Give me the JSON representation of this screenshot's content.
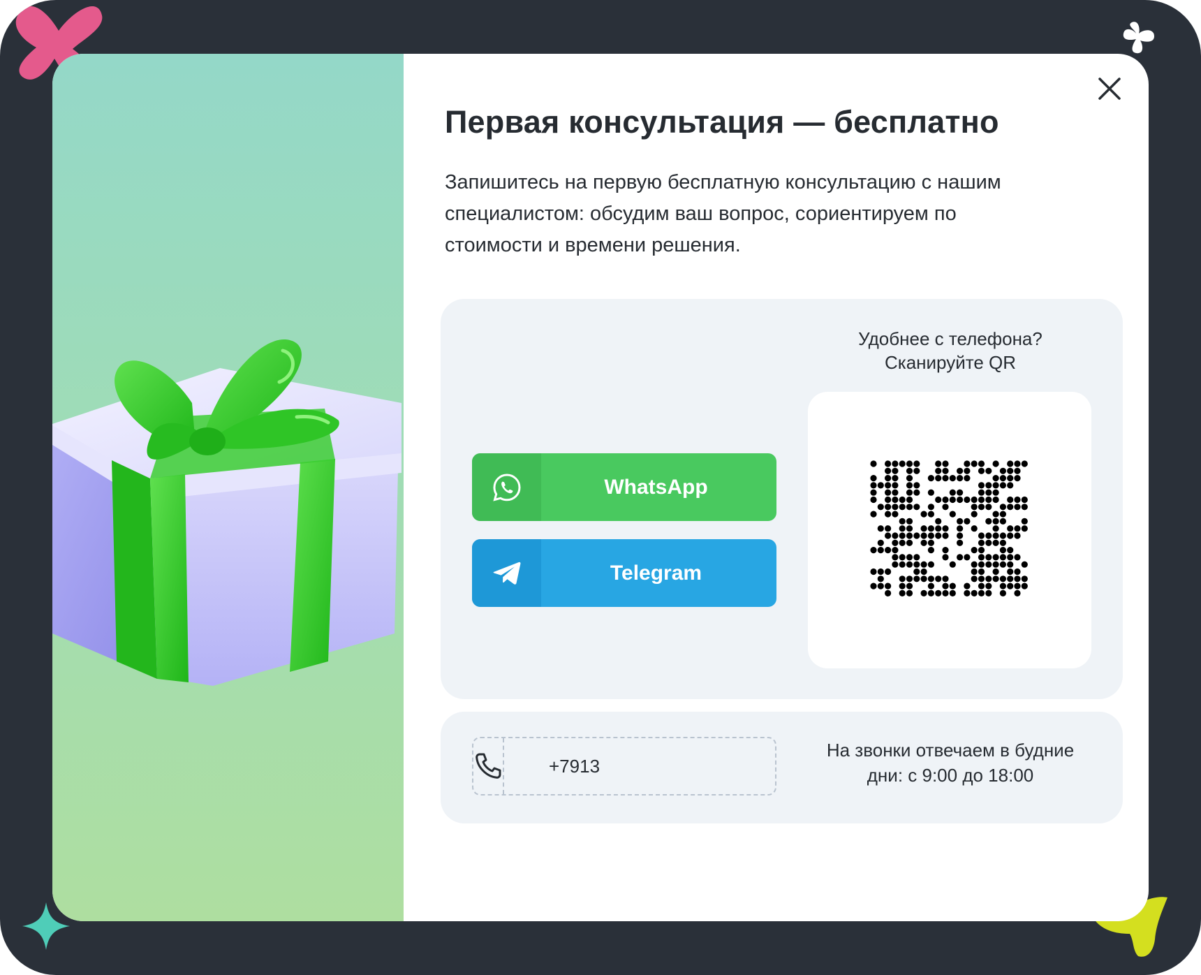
{
  "modal": {
    "title": "Первая консультация — бесплатно",
    "description": "Запишитесь на первую бесплатную консультацию с нашим специалистом: обсудим ваш вопрос, сориентируем по стоимости и времени решения.",
    "close_icon": "close-icon"
  },
  "messengers": {
    "whatsapp": {
      "label": "WhatsApp",
      "icon": "whatsapp-icon",
      "color": "#49c95f"
    },
    "telegram": {
      "label": "Telegram",
      "icon": "telegram-icon",
      "color": "#28a6e3"
    }
  },
  "qr": {
    "caption_line1": "Удобнее с телефона?",
    "caption_line2": "Сканируйте QR"
  },
  "phone": {
    "value": "+7913",
    "icon": "phone-icon",
    "hours_line1": "На звонки отвечаем в будние",
    "hours_line2": "дни: с 9:00 до 18:00"
  },
  "colors": {
    "frame": "#2a3039",
    "accent_green": "#49c95f",
    "accent_blue": "#28a6e3",
    "card_bg": "#eff3f7",
    "text": "#262b31"
  }
}
